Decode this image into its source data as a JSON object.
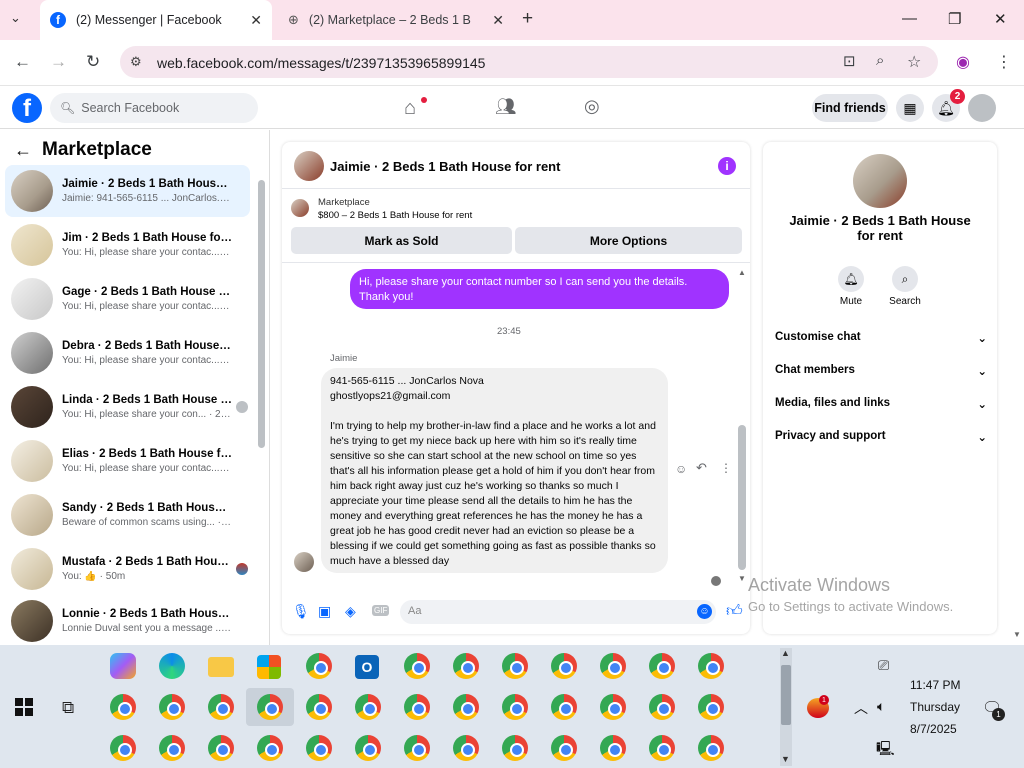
{
  "browser": {
    "tabs": [
      {
        "title": "(2) Messenger | Facebook",
        "active": true
      },
      {
        "title": "(2) Marketplace – 2 Beds 1 Bath",
        "active": false
      }
    ],
    "url": "web.facebook.com/messages/t/23971353965899145",
    "new_tab_label": "+"
  },
  "fb_header": {
    "search_placeholder": "Search Facebook",
    "find_friends": "Find friends",
    "notification_count": "2"
  },
  "sidebar": {
    "title": "Marketplace",
    "conversations": [
      {
        "name": "Jaimie · 2 Beds 1 Bath House fo...",
        "preview": "Jaimie: 941-565-6115 ... JonCarlos... · 2m",
        "active": true
      },
      {
        "name": "Jim · 2 Beds 1 Bath House for re...",
        "preview": "You: Hi, please share your contac... · 14m"
      },
      {
        "name": "Gage · 2 Beds 1 Bath House for ...",
        "preview": "You: Hi, please share your contac... · 14m"
      },
      {
        "name": "Debra · 2 Beds 1 Bath House for...",
        "preview": "You: Hi, please share your contac... · 14m"
      },
      {
        "name": "Linda · 2 Beds 1 Bath House f...",
        "preview": "You: Hi, please share your con... · 20m"
      },
      {
        "name": "Elias · 2 Beds 1 Bath House for r...",
        "preview": "You: Hi, please share your contac... · 29m"
      },
      {
        "name": "Sandy · 2 Beds 1 Bath House for...",
        "preview": "Beware of common scams using... · 50m"
      },
      {
        "name": "Mustafa · 2 Beds 1 Bath Hous...",
        "preview": "You: 👍 · 50m"
      },
      {
        "name": "Lonnie · 2 Beds 1 Bath House fo...",
        "preview": "Lonnie Duval sent you a message ... · 5h"
      }
    ]
  },
  "chat": {
    "title": "Jaimie · 2 Beds 1 Bath House for rent",
    "listing_source": "Marketplace",
    "listing_title": "$800 – 2 Beds 1 Bath House for rent",
    "mark_sold": "Mark as Sold",
    "more_options": "More Options",
    "outgoing_message": "Hi, please share your contact number so I can send you the details. Thank you!",
    "timestamp": "23:45",
    "sender": "Jaimie",
    "incoming_message": "941-565-6115 ... JonCarlos Nova\nghostlyops21@gmail.com\n\nI'm trying to help my brother-in-law find a place and he works a lot and he's trying to get my niece back up here with him so it's really time sensitive so she can start school at the new school on time so yes that's all his information please get a hold of him if you don't hear from him back right away just cuz he's working so thanks so much I appreciate your time please send all the details to him he has the money and everything great references he has the money he has a great job he has good credit never had an eviction so please be a blessing if we could get something going as fast as possible thanks so much have a blessed day",
    "composer_placeholder": "Aa"
  },
  "details": {
    "title": "Jaimie · 2 Beds 1 Bath House for rent",
    "mute": "Mute",
    "search": "Search",
    "sections": [
      "Customise chat",
      "Chat members",
      "Media, files and links",
      "Privacy and support"
    ]
  },
  "watermark": {
    "line1": "Activate Windows",
    "line2": "Go to Settings to activate Windows."
  },
  "taskbar": {
    "time": "11:47 PM",
    "day": "Thursday",
    "date": "8/7/2025",
    "notification_badge": "1",
    "weather_badge": "1"
  },
  "colors": {
    "fb_blue": "#0866ff",
    "messenger_purple": "#a033ff",
    "tab_strip": "#fbe3ec",
    "taskbar": "#dfe6ee"
  }
}
